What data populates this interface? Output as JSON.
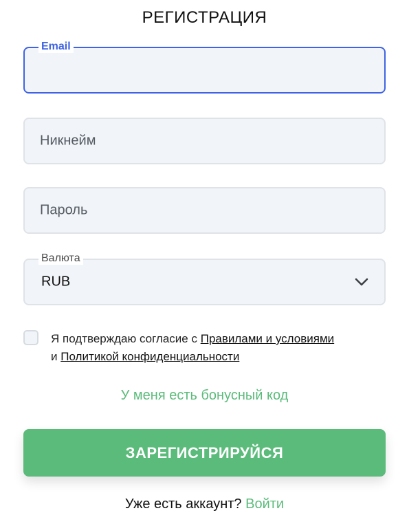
{
  "title": "РЕГИСТРАЦИЯ",
  "email_field": {
    "label": "Email",
    "value": ""
  },
  "nickname_field": {
    "placeholder": "Никнейм"
  },
  "password_field": {
    "placeholder": "Пароль"
  },
  "currency_field": {
    "label": "Валюта",
    "selected": "RUB",
    "icon": "chevron-down-icon"
  },
  "consent": {
    "text_prefix": "Я подтверждаю согласие с ",
    "terms_link": "Правилами и условиями",
    "conjunction": " и ",
    "privacy_link": "Политикой конфиденциальности",
    "checked": false
  },
  "bonus_link": "У меня есть бонусный код",
  "register_button": "ЗАРЕГИСТРИРУЙСЯ",
  "login_prompt": {
    "text": "Уже есть аккаунт?",
    "link": "Войти"
  },
  "colors": {
    "accent_green": "#5bbb7b",
    "focus_blue": "#3f63e3",
    "field_bg": "#f1f4f8",
    "field_border": "#dfe3e8"
  }
}
